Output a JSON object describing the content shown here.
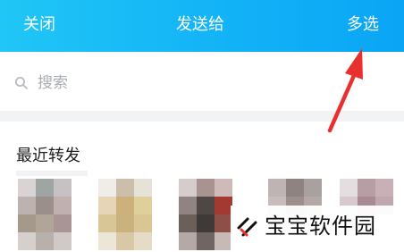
{
  "header": {
    "close_label": "关闭",
    "title": "发送给",
    "multiselect_label": "多选",
    "colors": {
      "start": "#20c6f5",
      "end": "#0aa5f5"
    }
  },
  "search": {
    "placeholder": "搜索",
    "icon": "search-icon"
  },
  "recent": {
    "title": "最近转发"
  },
  "annotation": {
    "arrow_color": "#e8302e"
  },
  "watermark": {
    "text": "宝宝软件园"
  }
}
